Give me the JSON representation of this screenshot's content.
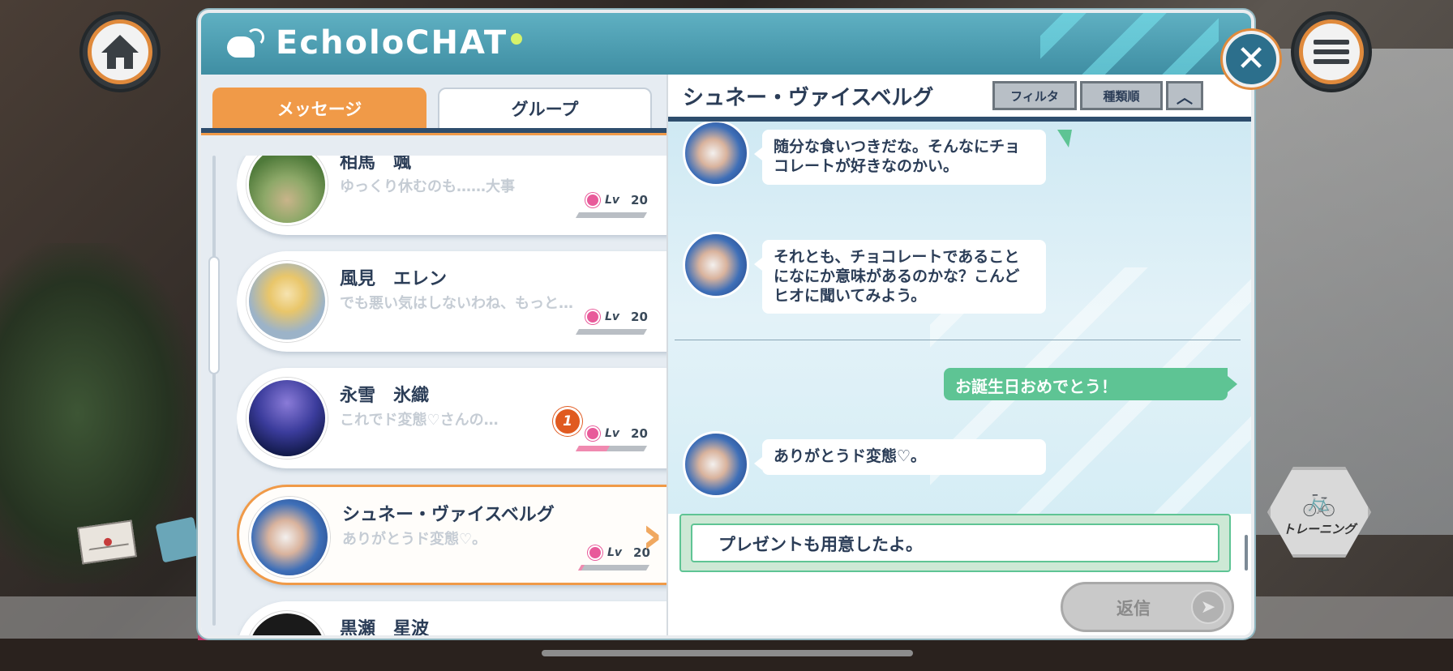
{
  "app": {
    "logo_text": "EcholoCHAT",
    "accent_color": "#f09a48",
    "header_color": "#3f8ea3"
  },
  "nav": {
    "home_icon": "home-icon",
    "menu_icon": "hamburger-menu-icon",
    "close_icon": "close-icon",
    "close_glyph": "✕"
  },
  "tabs": {
    "messages": "メッセージ",
    "group": "グループ"
  },
  "contacts": [
    {
      "name": "相馬　颯",
      "preview": "ゆっくり休むのも……大事",
      "lv_label": "Lv",
      "level": "20",
      "affinity_fill": 0,
      "selected": false
    },
    {
      "name": "風見　エレン",
      "preview": "でも悪い気はしないわね、もっと…",
      "lv_label": "Lv",
      "level": "20",
      "affinity_fill": 0,
      "selected": false
    },
    {
      "name": "永雪　氷織",
      "preview": "これでド変態♡さんの…",
      "lv_label": "Lv",
      "level": "20",
      "affinity_fill": 0.45,
      "selected": false
    },
    {
      "name": "シュネー・ヴァイスベルグ",
      "preview": "ありがとうド変態♡。",
      "lv_label": "Lv",
      "level": "20",
      "affinity_fill": 0.05,
      "selected": true,
      "unread": "1"
    },
    {
      "name": "黒瀬　星波",
      "preview": "",
      "lv_label": "",
      "level": "",
      "affinity_fill": 0,
      "selected": false
    }
  ],
  "chat": {
    "title": "シュネー・ヴァイスベルグ",
    "filter_label": "フィルタ",
    "sort_label": "種類順",
    "collapse_glyph": "︿",
    "messages": [
      {
        "from": "contact",
        "text": "随分な食いつきだな。そんなにチョコレートが好きなのかい。"
      },
      {
        "from": "contact",
        "text": "それとも、チョコレートであることになにか意味があるのかな？こんどヒオに聞いてみよう。"
      },
      {
        "from": "me",
        "text": "お誕生日おめでとう！"
      },
      {
        "from": "contact",
        "text": "ありがとうド変態♡。"
      }
    ],
    "reply_option": "プレゼントも用意したよ。",
    "send_label": "返信",
    "send_glyph": "➤"
  },
  "hud": {
    "training_label": "トレーニング",
    "training_glyph": "🚲"
  }
}
